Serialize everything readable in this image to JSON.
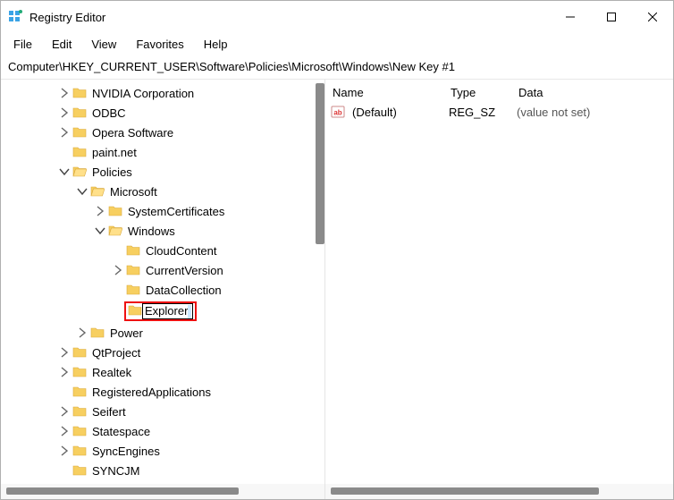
{
  "window": {
    "title": "Registry Editor"
  },
  "menu": {
    "file": "File",
    "edit": "Edit",
    "view": "View",
    "favorites": "Favorites",
    "help": "Help"
  },
  "address": "Computer\\HKEY_CURRENT_USER\\Software\\Policies\\Microsoft\\Windows\\New Key #1",
  "tree": {
    "nvidia": "NVIDIA Corporation",
    "odbc": "ODBC",
    "opera": "Opera Software",
    "paintnet": "paint.net",
    "policies": "Policies",
    "microsoft": "Microsoft",
    "syscert": "SystemCertificates",
    "windows": "Windows",
    "cloud": "CloudContent",
    "currentver": "CurrentVersion",
    "datacoll": "DataCollection",
    "explorer": "Explorer",
    "power": "Power",
    "qtproject": "QtProject",
    "realtek": "Realtek",
    "regapps": "RegisteredApplications",
    "seifert": "Seifert",
    "statespace": "Statespace",
    "syncengines": "SyncEngines",
    "syncjm": "SYNCJM"
  },
  "columns": {
    "name": "Name",
    "type": "Type",
    "data": "Data"
  },
  "values": [
    {
      "name": "(Default)",
      "type": "REG_SZ",
      "data": "(value not set)"
    }
  ]
}
